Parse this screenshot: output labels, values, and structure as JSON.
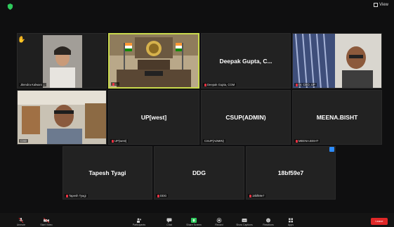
{
  "top_bar": {
    "view_label": "View"
  },
  "tiles": [
    {
      "id": "t1",
      "caption": "Jitendra Kalwani ...",
      "name": ""
    },
    {
      "id": "t2",
      "caption": "...",
      "name": ""
    },
    {
      "id": "t3",
      "caption": "Deepak Gupta, CGM",
      "name": "Deepak Gupta, C..."
    },
    {
      "id": "t4",
      "caption": "Dr. CEO, UP",
      "name": ""
    },
    {
      "id": "t5",
      "caption": "CSD",
      "name": ""
    },
    {
      "id": "t6",
      "caption": "UP(west)",
      "name": "UP[west]"
    },
    {
      "id": "t7",
      "caption": "CSUP(ADMIN)",
      "name": "CSUP(ADMIN)"
    },
    {
      "id": "t8",
      "caption": "MEENA.BISHT",
      "name": "MEENA.BISHT"
    },
    {
      "id": "t9",
      "caption": "Tapesh Tyagi",
      "name": "Tapesh Tyagi"
    },
    {
      "id": "t10",
      "caption": "DDG",
      "name": "DDG"
    },
    {
      "id": "t11",
      "caption": "18bf59e7",
      "name": "18bf59e7"
    }
  ],
  "toolbar": {
    "items": [
      {
        "label": "Unmute"
      },
      {
        "label": "Start Video"
      },
      {
        "label": "Participants"
      },
      {
        "label": "Chat"
      },
      {
        "label": "Share Screen"
      },
      {
        "label": "Record"
      },
      {
        "label": "Show Captions"
      },
      {
        "label": "Reactions"
      },
      {
        "label": "Apps"
      }
    ],
    "leave_label": "Leave",
    "participant_count": "11"
  },
  "colors": {
    "active_border": "#c9d94d",
    "leave": "#e02828",
    "accent": "#2d8cff"
  }
}
